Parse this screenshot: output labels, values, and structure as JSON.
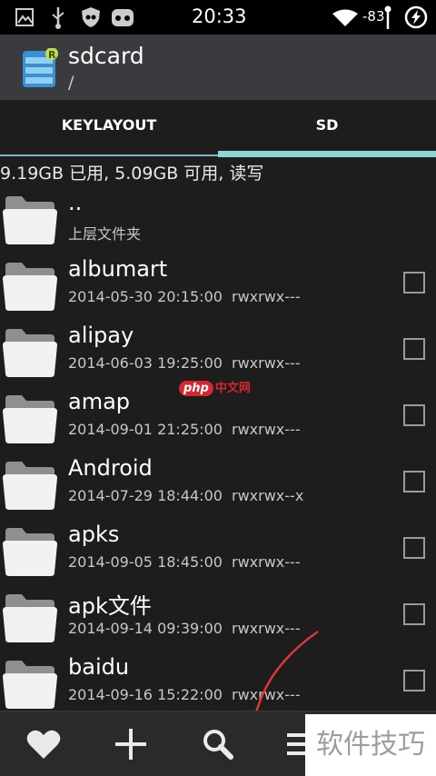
{
  "status_bar": {
    "time": "20:33",
    "signal": "-83",
    "icons": [
      "image-icon",
      "usb-icon",
      "shield-icon",
      "android-icon",
      "wifi-icon",
      "antenna-icon",
      "charge-icon"
    ]
  },
  "action_bar": {
    "title": "sdcard",
    "path": "/"
  },
  "tabs": [
    {
      "label": "KEYLAYOUT",
      "active": false
    },
    {
      "label": "SD",
      "active": true
    }
  ],
  "storage_info": "9.19GB 已用, 5.09GB 可用, 读写",
  "parent": {
    "name": "..",
    "label": "上层文件夹"
  },
  "files": [
    {
      "name": "albumart",
      "date": "2014-05-30 20:15:00",
      "perm": "rwxrwx---"
    },
    {
      "name": "alipay",
      "date": "2014-06-03 19:25:00",
      "perm": "rwxrwx---"
    },
    {
      "name": "amap",
      "date": "2014-09-01 21:25:00",
      "perm": "rwxrwx---"
    },
    {
      "name": "Android",
      "date": "2014-07-29 18:44:00",
      "perm": "rwxrwx--x"
    },
    {
      "name": "apks",
      "date": "2014-09-05 18:45:00",
      "perm": "rwxrwx---"
    },
    {
      "name": "apk文件",
      "date": "2014-09-14 09:39:00",
      "perm": "rwxrwx---"
    },
    {
      "name": "baidu",
      "date": "2014-09-16 15:22:00",
      "perm": "rwxrwx---"
    }
  ],
  "bottom_bar": [
    "favorite-icon",
    "add-icon",
    "search-icon",
    "menu-icon"
  ],
  "overlays": {
    "php_badge": "php",
    "php_text": "中文网",
    "watermark": "软件技巧"
  },
  "colors": {
    "accent": "#8ed3d8",
    "action_bar": "#3a3b3f",
    "background": "#1d1d1d",
    "arrow": "#e0353b"
  }
}
